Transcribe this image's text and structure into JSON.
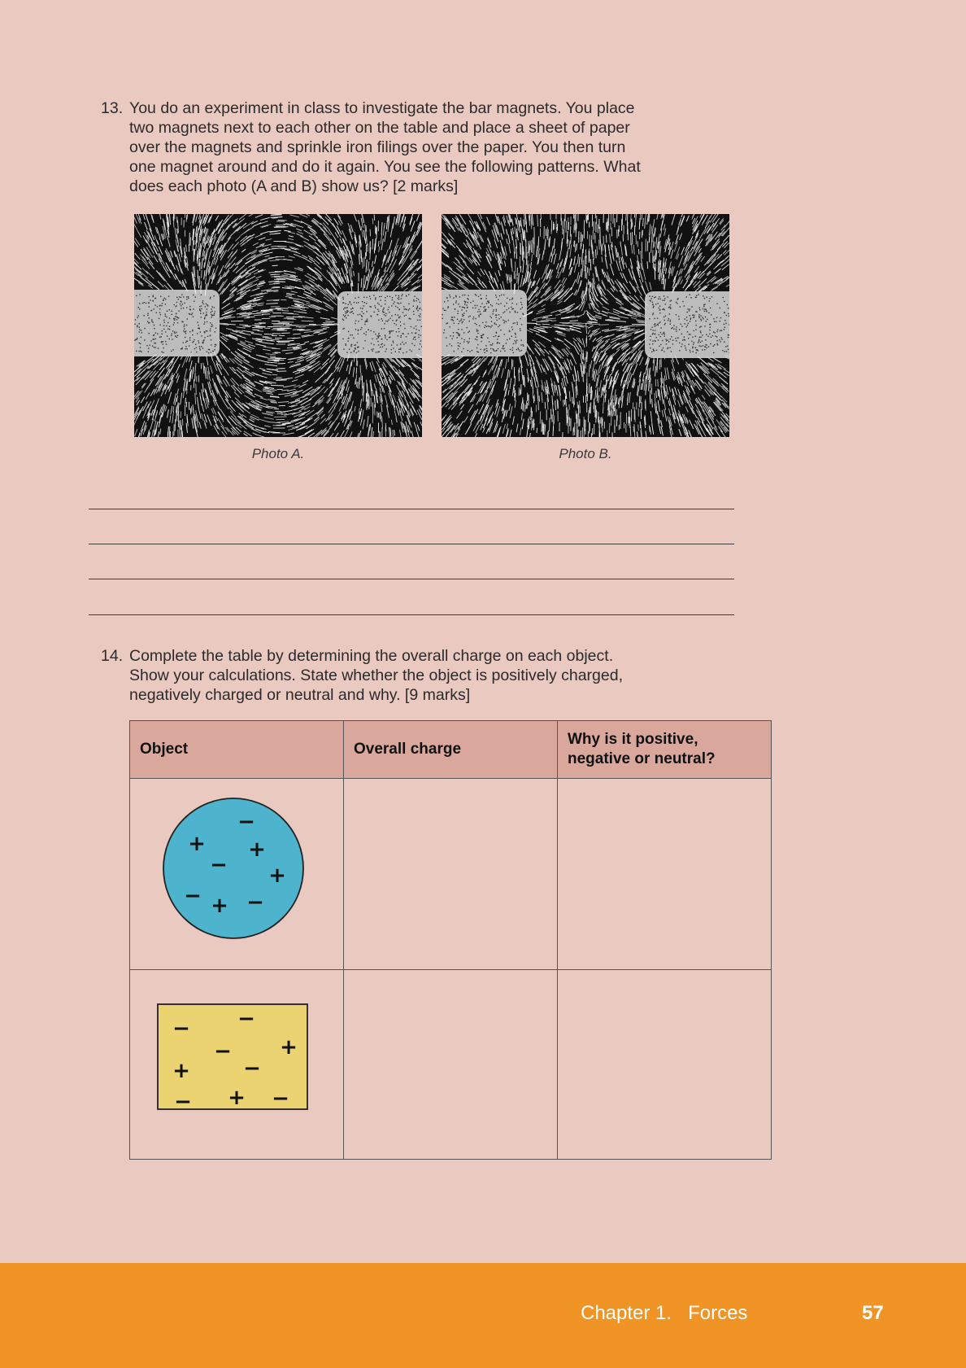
{
  "question13": {
    "number": "13.",
    "lines": [
      "You do an experiment in class to investigate the bar magnets. You place",
      "two magnets next to each other on the table and place a sheet of paper",
      "over the magnets and sprinkle iron filings over the paper. You then turn",
      "one magnet around and do it again. You see the following patterns. What",
      "does each photo (A and B) show us? [2 marks]"
    ],
    "photo_a_caption": "Photo A.",
    "photo_b_caption": "Photo B."
  },
  "question14": {
    "number": "14.",
    "lines": [
      "Complete the table by determining the overall charge on each object.",
      "Show your calculations. State whether the object is positively charged,",
      "negatively charged or neutral and why. [9 marks]"
    ],
    "table": {
      "headers": [
        "Object",
        "Overall charge",
        "Why is it positive, negative or neutral?"
      ],
      "header_lines_col3": [
        "Why is it positive,",
        "negative or neutral?"
      ],
      "rows": [
        {
          "object": "circle",
          "fill": "#4eb3cc",
          "charges": [
            "−",
            "+",
            "+",
            "−",
            "+",
            "−",
            "+",
            "−"
          ]
        },
        {
          "object": "rectangle",
          "fill": "#ead370",
          "charges": [
            "−",
            "−",
            "−",
            "+",
            "+",
            "−",
            "−",
            "+",
            "−"
          ]
        }
      ]
    }
  },
  "footer": {
    "chapter": "Chapter 1.",
    "title": "Forces",
    "page": "57",
    "color": "#ef9425"
  }
}
